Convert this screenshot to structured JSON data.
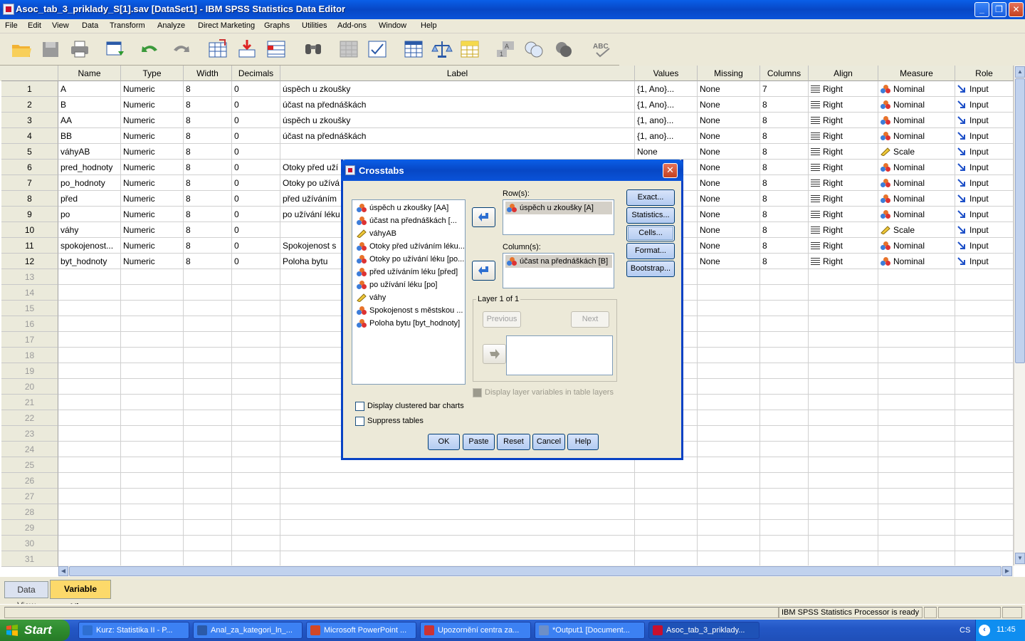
{
  "window": {
    "title": "Asoc_tab_3_priklady_S[1].sav [DataSet1] - IBM SPSS Statistics Data Editor"
  },
  "menu": [
    "File",
    "Edit",
    "View",
    "Data",
    "Transform",
    "Analyze",
    "Direct Marketing",
    "Graphs",
    "Utilities",
    "Add-ons",
    "Window",
    "Help"
  ],
  "columns": [
    "Name",
    "Type",
    "Width",
    "Decimals",
    "Label",
    "Values",
    "Missing",
    "Columns",
    "Align",
    "Measure",
    "Role"
  ],
  "variables": [
    {
      "num": "1",
      "name": "A",
      "type": "Numeric",
      "width": "8",
      "decimals": "0",
      "label": "úspěch u zkoušky",
      "values": "{1, Ano}...",
      "missing": "None",
      "columns": "7",
      "align": "Right",
      "measure": "Nominal",
      "role": "Input"
    },
    {
      "num": "2",
      "name": "B",
      "type": "Numeric",
      "width": "8",
      "decimals": "0",
      "label": "účast na přednáškách",
      "values": "{1, Ano}...",
      "missing": "None",
      "columns": "8",
      "align": "Right",
      "measure": "Nominal",
      "role": "Input"
    },
    {
      "num": "3",
      "name": "AA",
      "type": "Numeric",
      "width": "8",
      "decimals": "0",
      "label": "úspěch u zkoušky",
      "values": "{1, ano}...",
      "missing": "None",
      "columns": "8",
      "align": "Right",
      "measure": "Nominal",
      "role": "Input"
    },
    {
      "num": "4",
      "name": "BB",
      "type": "Numeric",
      "width": "8",
      "decimals": "0",
      "label": "účast na přednáškách",
      "values": "{1, ano}...",
      "missing": "None",
      "columns": "8",
      "align": "Right",
      "measure": "Nominal",
      "role": "Input"
    },
    {
      "num": "5",
      "name": "váhyAB",
      "type": "Numeric",
      "width": "8",
      "decimals": "0",
      "label": "",
      "values": "None",
      "missing": "None",
      "columns": "8",
      "align": "Right",
      "measure": "Scale",
      "role": "Input"
    },
    {
      "num": "6",
      "name": "pred_hodnoty",
      "type": "Numeric",
      "width": "8",
      "decimals": "0",
      "label": "Otoky před uží",
      "values": "",
      "missing": "None",
      "columns": "8",
      "align": "Right",
      "measure": "Nominal",
      "role": "Input"
    },
    {
      "num": "7",
      "name": "po_hodnoty",
      "type": "Numeric",
      "width": "8",
      "decimals": "0",
      "label": "Otoky po užívá",
      "values": "",
      "missing": "None",
      "columns": "8",
      "align": "Right",
      "measure": "Nominal",
      "role": "Input"
    },
    {
      "num": "8",
      "name": "před",
      "type": "Numeric",
      "width": "8",
      "decimals": "0",
      "label": "před užíváním",
      "values": "",
      "missing": "None",
      "columns": "8",
      "align": "Right",
      "measure": "Nominal",
      "role": "Input"
    },
    {
      "num": "9",
      "name": "po",
      "type": "Numeric",
      "width": "8",
      "decimals": "0",
      "label": "po užívání léku",
      "values": "",
      "missing": "None",
      "columns": "8",
      "align": "Right",
      "measure": "Nominal",
      "role": "Input"
    },
    {
      "num": "10",
      "name": "váhy",
      "type": "Numeric",
      "width": "8",
      "decimals": "0",
      "label": "",
      "values": "",
      "missing": "None",
      "columns": "8",
      "align": "Right",
      "measure": "Scale",
      "role": "Input"
    },
    {
      "num": "11",
      "name": "spokojenost...",
      "type": "Numeric",
      "width": "8",
      "decimals": "0",
      "label": "Spokojenost s",
      "values": "",
      "missing": "None",
      "columns": "8",
      "align": "Right",
      "measure": "Nominal",
      "role": "Input"
    },
    {
      "num": "12",
      "name": "byt_hodnoty",
      "type": "Numeric",
      "width": "8",
      "decimals": "0",
      "label": "Poloha bytu",
      "values": "}...",
      "missing": "None",
      "columns": "8",
      "align": "Right",
      "measure": "Nominal",
      "role": "Input"
    }
  ],
  "empty_rows": [
    "13",
    "14",
    "15",
    "16",
    "17",
    "18",
    "19",
    "20",
    "21",
    "22",
    "23",
    "24",
    "25",
    "26",
    "27",
    "28",
    "29",
    "30",
    "31"
  ],
  "tabs": {
    "data_view": "Data View",
    "variable_view": "Variable View"
  },
  "status": "IBM SPSS Statistics Processor is ready",
  "dialog": {
    "title": "Crosstabs",
    "source_list": [
      {
        "label": "úspěch u zkoušky [AA]",
        "kind": "nominal"
      },
      {
        "label": "účast na přednáškách [...",
        "kind": "nominal"
      },
      {
        "label": "váhyAB",
        "kind": "scale"
      },
      {
        "label": "Otoky před užíváním léku...",
        "kind": "nominal"
      },
      {
        "label": "Otoky po užívání léku [po...",
        "kind": "nominal"
      },
      {
        "label": "před užíváním léku [před]",
        "kind": "nominal"
      },
      {
        "label": "po užívání léku [po]",
        "kind": "nominal"
      },
      {
        "label": "váhy",
        "kind": "scale"
      },
      {
        "label": "Spokojenost s městskou ...",
        "kind": "nominal"
      },
      {
        "label": "Poloha bytu [byt_hodnoty]",
        "kind": "nominal"
      }
    ],
    "rows_label": "Row(s):",
    "rows_item": "úspěch u zkoušky [A]",
    "columns_label": "Column(s):",
    "columns_item": "účast na přednáškách [B]",
    "layer_label": "Layer 1 of 1",
    "previous": "Previous",
    "next": "Next",
    "display_layer": "Display layer variables in table layers",
    "clustered_bar": "Display clustered bar charts",
    "suppress": "Suppress tables",
    "side_buttons": [
      "Exact...",
      "Statistics...",
      "Cells...",
      "Format...",
      "Bootstrap..."
    ],
    "bottom_buttons": [
      "OK",
      "Paste",
      "Reset",
      "Cancel",
      "Help"
    ]
  },
  "taskbar": {
    "start": "Start",
    "tasks": [
      "Kurz: Statistika II - P...",
      "Anal_za_kategori_ln_...",
      "Microsoft PowerPoint ...",
      "Upozornění centra za...",
      "*Output1 [Document...",
      "Asoc_tab_3_priklady..."
    ],
    "lang": "CS",
    "clock": "11:45"
  },
  "colors": {
    "title_blue": "#0747c5",
    "active_tab": "#fcd96a",
    "scrollbar": "#c1d2ee"
  }
}
